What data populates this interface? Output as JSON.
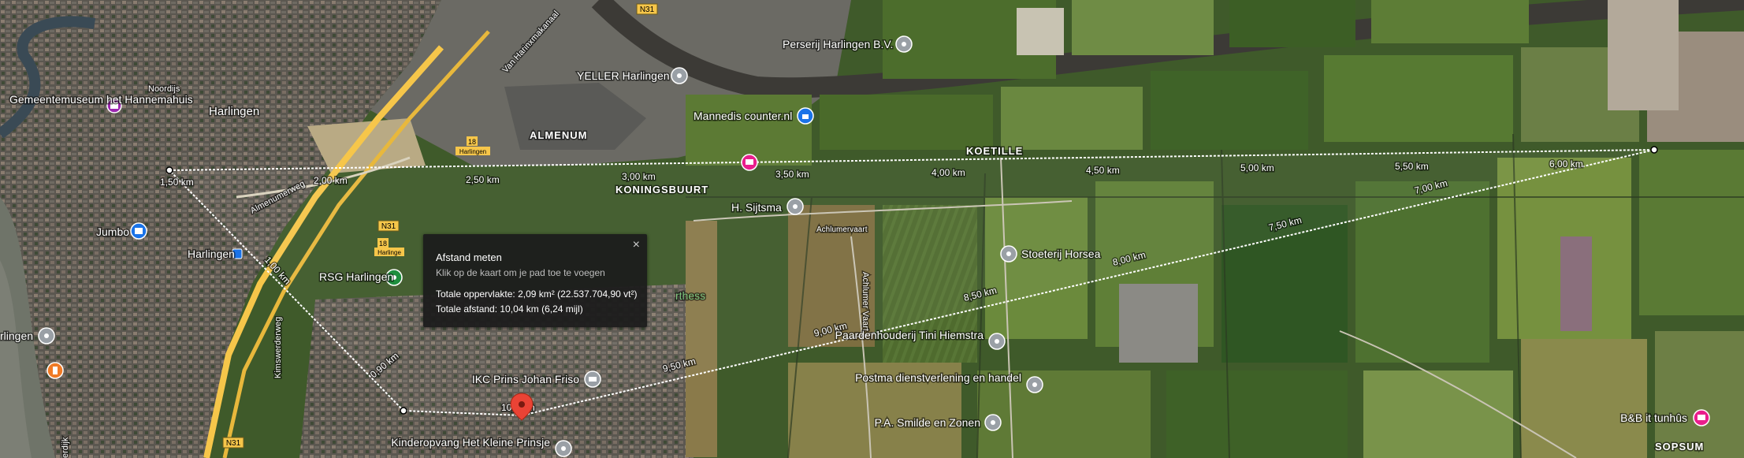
{
  "measure_panel": {
    "title": "Afstand meten",
    "hint": "Klik op de kaart om je pad toe te voegen",
    "area": "Totale oppervlakte: 2,09 km² (22.537.704,90 vt²)",
    "distance": "Totale afstand: 10,04 km (6,24 mijl)",
    "close": "×"
  },
  "distance_labels": [
    "1,50 km",
    "2,00 km",
    "2,50 km",
    "3,00 km",
    "3,50 km",
    "4,00 km",
    "4,50 km",
    "5,00 km",
    "5,50 km",
    "6,00 km",
    "7,00 km",
    "7,50 km",
    "8,00 km",
    "8,50 km",
    "9,00 km",
    "9,50 km",
    "10,0 km",
    "0,90 km",
    "1,00 km"
  ],
  "places": {
    "gemeentemuseum": "Gemeentemuseum het Hannemahuis",
    "harlingen_city": "Harlingen",
    "noordijs": "Noordijs",
    "yeller": "YELLER Harlingen",
    "perserij": "Perserij Harlingen B.V.",
    "manned": "Mannedis counter.nl",
    "almenum": "ALMENUM",
    "koningsbuurt": "KONINGSBUURT",
    "koetille": "KOETILLE",
    "sijtsma": "H. Sijtsma",
    "jumbo": "Jumbo",
    "station": "Harlingen",
    "rsg": "RSG Harlingen",
    "stoeterij": "Stoeterij Horsea",
    "paardenhouderij": "Paardenhouderij Tini Hiemstra",
    "postma": "Postma dienstverlening en handel",
    "smilde": "P.A. Smilde en Zonen",
    "ikc": "IKC Prins Johan Friso",
    "kinderopvang": "Kinderopvang Het Kleine Prinsje",
    "bnb": "B&B it tunhûs",
    "sopsum": "SOPSUM",
    "harlingen_left": "rlingen",
    "fitness": "rthess"
  },
  "roads": {
    "n31_a": "N31",
    "n31_b": "N31",
    "n31_c": "N31",
    "r18_a": "18",
    "r18_b": "18",
    "harlingen_shield": "Harlingen",
    "harlingen_shield_b": "Harlinge",
    "almenumerweg": "Almenumerweg",
    "achlumervaart": "Achlumervaart",
    "achlumervaart_v": "Achlumer Vaart",
    "kimswerderweg": "Kimswerderweg",
    "vierdijk": "erdijk",
    "vanharingen": "Van Harinxmakanaal"
  },
  "colors": {
    "measure_line": "#ffffff",
    "pin_red": "#ea4335",
    "poi_gray": "#9aa0a6",
    "poi_purple": "#9c27b0",
    "poi_pink": "#e91e8c",
    "poi_blue": "#1a73e8",
    "poi_green": "#1e8e3e",
    "poi_orange": "#f07b26",
    "road_yellow": "#f6c64a"
  }
}
